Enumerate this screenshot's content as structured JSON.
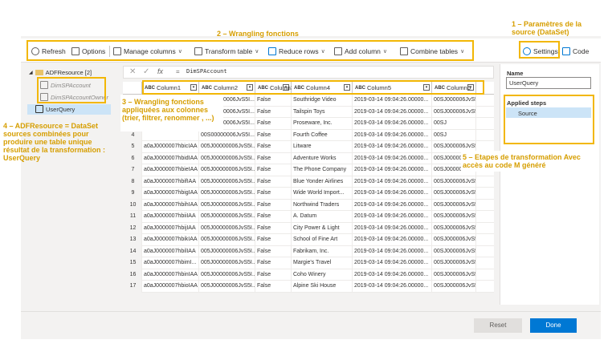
{
  "toolbar": {
    "refresh": "Refresh",
    "options": "Options",
    "manage_columns": "Manage columns",
    "transform_table": "Transform table",
    "reduce_rows": "Reduce rows",
    "add_column": "Add column",
    "combine_tables": "Combine tables",
    "settings": "Settings",
    "code": "Code"
  },
  "tree": {
    "root": "ADFResource [2]",
    "items": [
      "DimSPAccount",
      "DimSPAccountOwner"
    ],
    "query": "UserQuery"
  },
  "formula": {
    "fx": "fx",
    "eq": "=",
    "expr": "DimSPAccount"
  },
  "columns": [
    "Column1",
    "Column2",
    "Column3",
    "Column4",
    "Column5",
    "Column6"
  ],
  "column_types": [
    "ABC",
    "ABC",
    "ABC",
    "ABC",
    "ABC",
    "ABC"
  ],
  "rows": [
    {
      "n": "1",
      "c1": "",
      "c2": "00S00000006JvS5I...",
      "c3": "False",
      "c4": "Southridge Video",
      "c5": "2019-03-14 09:04:26.00000...",
      "c6": "00SJ000006JvS5"
    },
    {
      "n": "2",
      "c1": "",
      "c2": "00S00000006JvS5I...",
      "c3": "False",
      "c4": "Tailspin Toys",
      "c5": "2019-03-14 09:04:26.00000...",
      "c6": "00SJ000006JvS5"
    },
    {
      "n": "3",
      "c1": "",
      "c2": "00S00000006JvS5I...",
      "c3": "False",
      "c4": "Proseware, Inc.",
      "c5": "2019-03-14 09:04:26.00000...",
      "c6": "00SJ"
    },
    {
      "n": "4",
      "c1": "",
      "c2": "00S00000006JvS5I...",
      "c3": "False",
      "c4": "Fourth Coffee",
      "c5": "2019-03-14 09:04:26.00000...",
      "c6": "00SJ"
    },
    {
      "n": "5",
      "c1": "a0aJ0000007hbicIAA",
      "c2": "005J00000006JvS5I...",
      "c3": "False",
      "c4": "Litware",
      "c5": "2019-03-14 09:04:26.00000...",
      "c6": "00SJ000006JvS5"
    },
    {
      "n": "6",
      "c1": "a0aJ0000007hbidIAA",
      "c2": "005J00000006JvS5I...",
      "c3": "False",
      "c4": "Adventure Works",
      "c5": "2019-03-14 09:04:26.00000...",
      "c6": "00SJ000006JvS5"
    },
    {
      "n": "7",
      "c1": "a0aJ0000007hbieIAA",
      "c2": "005J00000006JvS5I...",
      "c3": "False",
      "c4": "The Phone Company",
      "c5": "2019-03-14 09:04:26.00000...",
      "c6": "00SJ000006JvS5"
    },
    {
      "n": "8",
      "c1": "a0aJ0000007hbifIAA",
      "c2": "005J00000006JvS5I...",
      "c3": "False",
      "c4": "Blue Yonder Airlines",
      "c5": "2019-03-14 09:04:26.00000...",
      "c6": "00SJ000006JvS5"
    },
    {
      "n": "9",
      "c1": "a0aJ0000007hbigIAA",
      "c2": "005J00000006JvS5I...",
      "c3": "False",
      "c4": "Wide World Import...",
      "c5": "2019-03-14 09:04:26.00000...",
      "c6": "00SJ000006JvS5"
    },
    {
      "n": "10",
      "c1": "a0aJ0000007hbihIAA",
      "c2": "005J00000006JvS5I...",
      "c3": "False",
      "c4": "Northwind Traders",
      "c5": "2019-03-14 09:04:26.00000...",
      "c6": "00SJ000006JvS5"
    },
    {
      "n": "11",
      "c1": "a0aJ0000007hbiiIAA",
      "c2": "005J00000006JvS5I...",
      "c3": "False",
      "c4": "A. Datum",
      "c5": "2019-03-14 09:04:26.00000...",
      "c6": "00SJ000006JvS5"
    },
    {
      "n": "12",
      "c1": "a0aJ0000007hbijIAA",
      "c2": "005J00000006JvS5I...",
      "c3": "False",
      "c4": "City Power & Light",
      "c5": "2019-03-14 09:04:26.00000...",
      "c6": "00SJ000006JvS5"
    },
    {
      "n": "13",
      "c1": "a0aJ0000007hbikIAA",
      "c2": "005J00000006JvS5I...",
      "c3": "False",
      "c4": "School of Fine Art",
      "c5": "2019-03-14 09:04:26.00000...",
      "c6": "00SJ000006JvS5"
    },
    {
      "n": "14",
      "c1": "a0aJ0000007hbilIAA",
      "c2": "005J00000006JvS5I...",
      "c3": "False",
      "c4": "Fabrikam, Inc.",
      "c5": "2019-03-14 09:04:26.00000...",
      "c6": "00SJ000006JvS5"
    },
    {
      "n": "15",
      "c1": "a0aJ0000007hbimI...",
      "c2": "005J00000006JvS5I...",
      "c3": "False",
      "c4": "Margie's Travel",
      "c5": "2019-03-14 09:04:26.00000...",
      "c6": "00SJ000006JvS5"
    },
    {
      "n": "16",
      "c1": "a0aJ0000007hbinIAA",
      "c2": "005J00000006JvS5I...",
      "c3": "False",
      "c4": "Coho Winery",
      "c5": "2019-03-14 09:04:26.00000...",
      "c6": "00SJ000006JvS5"
    },
    {
      "n": "17",
      "c1": "a0aJ0000007hbioIAA",
      "c2": "005J00000006JvS5I...",
      "c3": "False",
      "c4": "Alpine Ski House",
      "c5": "2019-03-14 09:04:26.00000...",
      "c6": "00SJ000006JvS5"
    }
  ],
  "right_panel": {
    "name_label": "Name",
    "name_value": "UserQuery",
    "steps_label": "Applied steps",
    "steps": [
      "Source"
    ]
  },
  "footer": {
    "reset": "Reset",
    "done": "Done"
  },
  "annotations": {
    "a1": "1 – Paramètres de la source (DataSet)",
    "a2": "2 – Wrangling fonctions",
    "a3": "3 – Wrangling fonctions appliquées aux colonnes (trier, filtrer, renommer , ...)",
    "a4": "4 – ADFResource = DataSet sources combinées pour produire une table unique résultat de la transformation : UserQuery",
    "a5": "5 – Etapes de transformation Avec accès au code M généré"
  },
  "colors": {
    "annotation": "#d69e00",
    "highlight_box": "#f2b705",
    "primary_button": "#0078d4",
    "selection": "#cce4f7"
  }
}
